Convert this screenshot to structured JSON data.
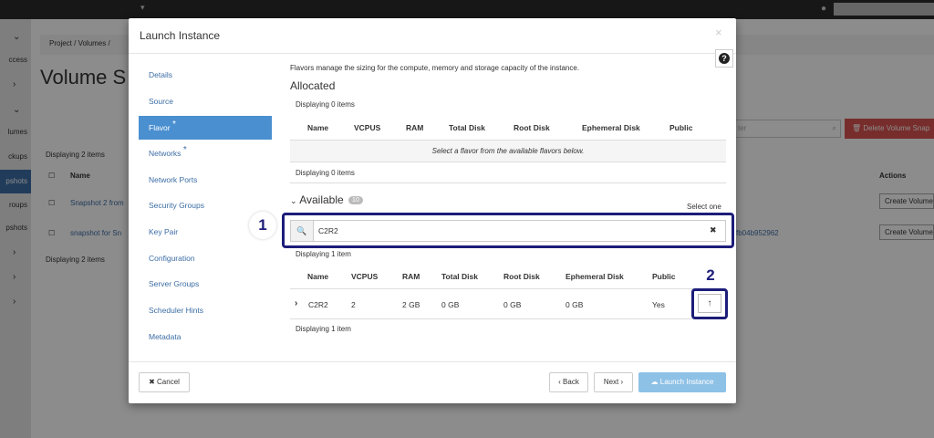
{
  "background": {
    "breadcrumb": "Project /  Volumes /",
    "page_title": "Volume S",
    "displaying_top": "Displaying 2 items",
    "displaying_bottom": "Displaying 2 items",
    "name_header": "Name",
    "actions_header": "Actions",
    "filter_placeholder": "ter",
    "delete_button": "Delete Volume Snap",
    "rows": [
      {
        "name": "Snapshot 2 from",
        "action": "Create Volume"
      },
      {
        "name": "snapshot for Sn",
        "id_fragment": "fb04b952962",
        "action": "Create Volume"
      }
    ],
    "sidebar": [
      "ccess",
      "lumes",
      "ckups",
      "pshots",
      "roups",
      "pshots"
    ]
  },
  "modal": {
    "title": "Launch Instance",
    "close": "×",
    "help": "?",
    "nav": [
      {
        "label": "Details",
        "required": false
      },
      {
        "label": "Source",
        "required": false
      },
      {
        "label": "Flavor",
        "required": true
      },
      {
        "label": "Networks",
        "required": true
      },
      {
        "label": "Network Ports",
        "required": false
      },
      {
        "label": "Security Groups",
        "required": false
      },
      {
        "label": "Key Pair",
        "required": false
      },
      {
        "label": "Configuration",
        "required": false
      },
      {
        "label": "Server Groups",
        "required": false
      },
      {
        "label": "Scheduler Hints",
        "required": false
      },
      {
        "label": "Metadata",
        "required": false
      }
    ],
    "required_mark": "*",
    "description": "Flavors manage the sizing for the compute, memory and storage capacity of the instance.",
    "allocated": {
      "heading": "Allocated",
      "displaying_top": "Displaying 0 items",
      "displaying_bottom": "Displaying 0 items",
      "empty_message": "Select a flavor from the available flavors below."
    },
    "columns": [
      "Name",
      "VCPUS",
      "RAM",
      "Total Disk",
      "Root Disk",
      "Ephemeral Disk",
      "Public"
    ],
    "available": {
      "heading": "Available",
      "count": "10",
      "select_hint": "Select one",
      "search_value": "C2R2",
      "displaying_top": "Displaying 1 item",
      "displaying_bottom": "Displaying 1 item",
      "rows": [
        {
          "name": "C2R2",
          "vcpus": "2",
          "ram": "2 GB",
          "total_disk": "0 GB",
          "root_disk": "0 GB",
          "ephemeral_disk": "0 GB",
          "public": "Yes"
        }
      ]
    },
    "callouts": [
      "1",
      "2"
    ],
    "footer": {
      "cancel": "Cancel",
      "back": "Back",
      "next": "Next",
      "launch": "Launch Instance"
    }
  }
}
